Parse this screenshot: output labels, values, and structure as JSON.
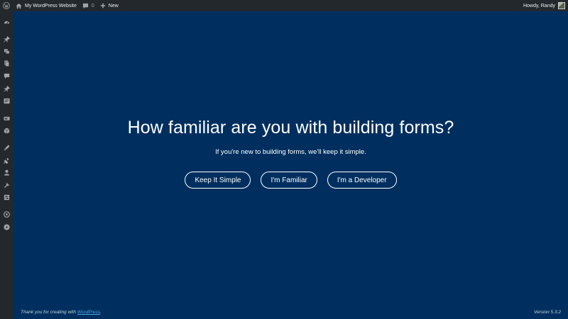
{
  "adminbar": {
    "site_name": "My WordPress Website",
    "comments_count": "0",
    "new_label": "New",
    "greeting": "Howdy, Randy"
  },
  "sidebar": {
    "icons": [
      "dashboard-icon",
      "pin-icon",
      "media-icon",
      "pages-icon",
      "comments-icon",
      "pin-icon",
      "wpforms-icon",
      "woo-icon",
      "products-icon",
      "appearance-icon",
      "plugins-icon",
      "users-icon",
      "tools-icon",
      "settings-icon",
      "circle-icon",
      "play-icon"
    ]
  },
  "main": {
    "question": "How familiar are you with building forms?",
    "subtitle": "If you're new to building forms, we'll keep it simple.",
    "choices": [
      "Keep It Simple",
      "I'm Familiar",
      "I'm a Developer"
    ]
  },
  "footer": {
    "thanks_prefix": "Thank you for creating with",
    "thanks_link": "WordPress",
    "thanks_suffix": ".",
    "version": "Version 5.3.2"
  },
  "colors": {
    "background": "#002f5f",
    "adminbar": "#23282d",
    "link": "#4fa3e0"
  }
}
